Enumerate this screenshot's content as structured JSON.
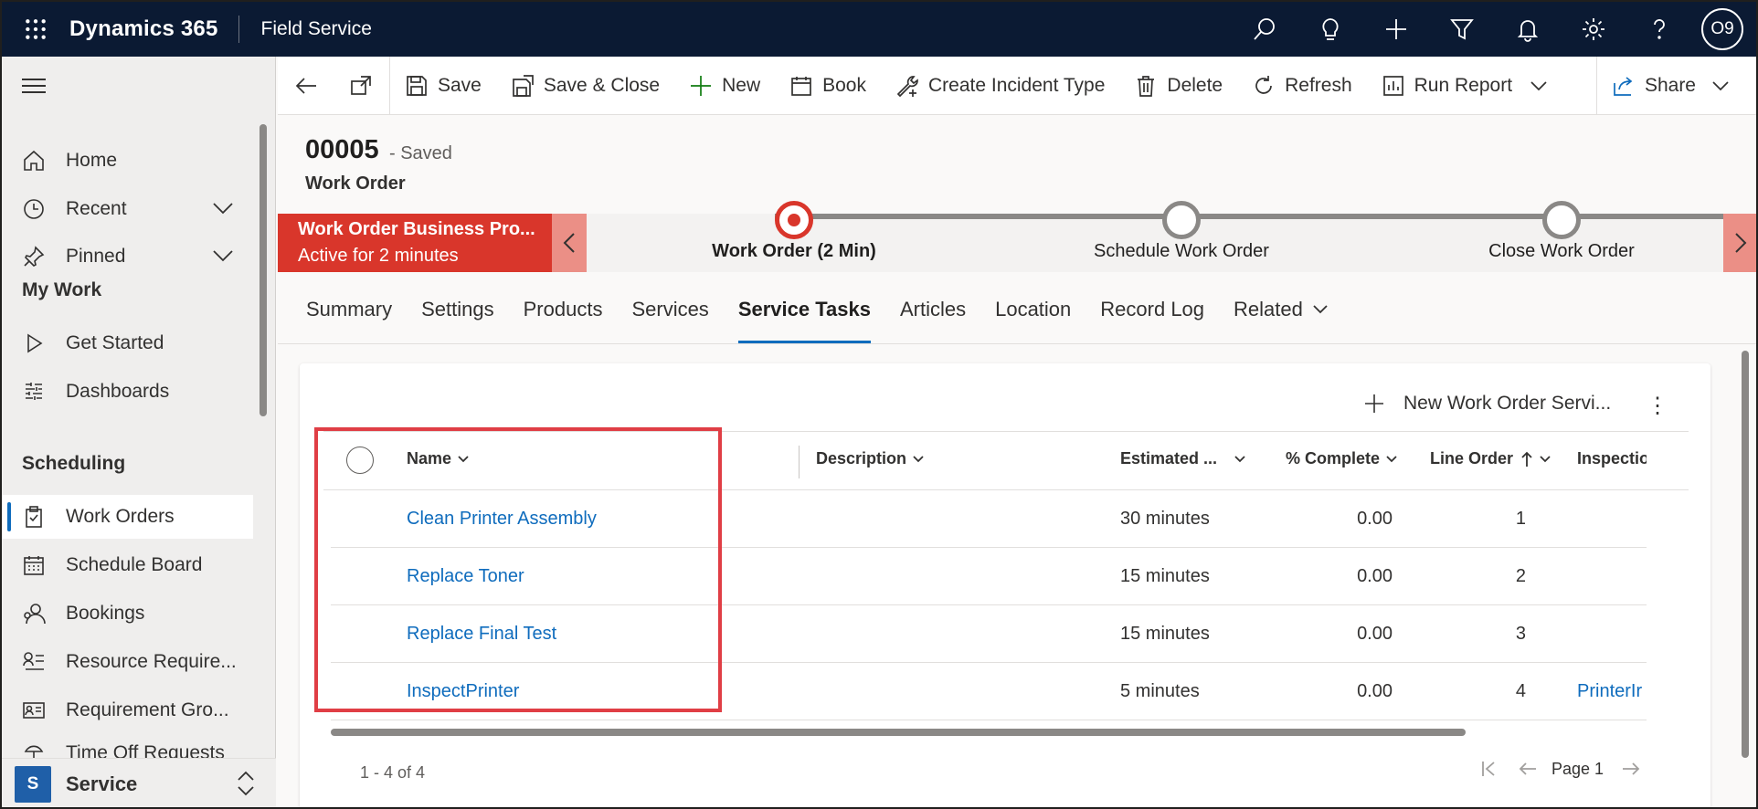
{
  "topbar": {
    "app_name": "Dynamics 365",
    "module": "Field Service",
    "icons": [
      "search-icon",
      "lightbulb-icon",
      "plus-icon",
      "filter-icon",
      "bell-icon",
      "gear-icon",
      "help-icon"
    ],
    "avatar": "O9"
  },
  "sidebar": {
    "items_top": [
      {
        "label": "Home",
        "icon": "home-icon"
      },
      {
        "label": "Recent",
        "icon": "clock-icon"
      },
      {
        "label": "Pinned",
        "icon": "pin-icon"
      }
    ],
    "my_work": {
      "title": "My Work",
      "items": [
        {
          "label": "Get Started",
          "icon": "play-icon"
        },
        {
          "label": "Dashboards",
          "icon": "dashboard-icon"
        }
      ]
    },
    "scheduling": {
      "title": "Scheduling",
      "items": [
        {
          "label": "Work Orders",
          "icon": "clipboard-icon"
        },
        {
          "label": "Schedule Board",
          "icon": "calendar-icon"
        },
        {
          "label": "Bookings",
          "icon": "people-icon"
        },
        {
          "label": "Resource Require...",
          "icon": "list-person-icon"
        },
        {
          "label": "Requirement Gro...",
          "icon": "contact-card-icon"
        },
        {
          "label": "Time Off Requests",
          "icon": "beach-icon"
        }
      ]
    },
    "area": {
      "badge": "S",
      "name": "Service"
    }
  },
  "commandbar": {
    "save": "Save",
    "save_close": "Save & Close",
    "new": "New",
    "book": "Book",
    "create_incident_type": "Create Incident Type",
    "delete": "Delete",
    "refresh": "Refresh",
    "run_report": "Run Report",
    "share": "Share"
  },
  "record": {
    "title": "00005",
    "status": "- Saved",
    "entity": "Work Order"
  },
  "bpf": {
    "name": "Work Order Business Pro...",
    "active_for": "Active for 2 minutes",
    "stages": [
      {
        "label": "Work Order  (2 Min)",
        "active": true
      },
      {
        "label": "Schedule Work Order",
        "active": false
      },
      {
        "label": "Close Work Order",
        "active": false
      }
    ]
  },
  "tabs": [
    "Summary",
    "Settings",
    "Products",
    "Services",
    "Service Tasks",
    "Articles",
    "Location",
    "Record Log",
    "Related"
  ],
  "grid": {
    "new_button": "New Work Order Servi...",
    "columns": [
      "Name",
      "Description",
      "Estimated ...",
      "% Complete",
      "Line Order",
      "Inspectio"
    ],
    "rows": [
      {
        "name": "Clean Printer Assembly",
        "description": "",
        "estimated": "30 minutes",
        "complete": "0.00",
        "line_order": "1",
        "inspection": ""
      },
      {
        "name": "Replace Toner",
        "description": "",
        "estimated": "15 minutes",
        "complete": "0.00",
        "line_order": "2",
        "inspection": ""
      },
      {
        "name": "Replace Final Test",
        "description": "",
        "estimated": "15 minutes",
        "complete": "0.00",
        "line_order": "3",
        "inspection": ""
      },
      {
        "name": "InspectPrinter",
        "description": "",
        "estimated": "5 minutes",
        "complete": "0.00",
        "line_order": "4",
        "inspection": "PrinterIr"
      }
    ],
    "count": "1 - 4 of 4",
    "page": "Page 1"
  },
  "colors": {
    "topbar": "#0b1a33",
    "bpf_active": "#d9362b",
    "link": "#0f6cbd",
    "highlight": "#e03e45"
  }
}
